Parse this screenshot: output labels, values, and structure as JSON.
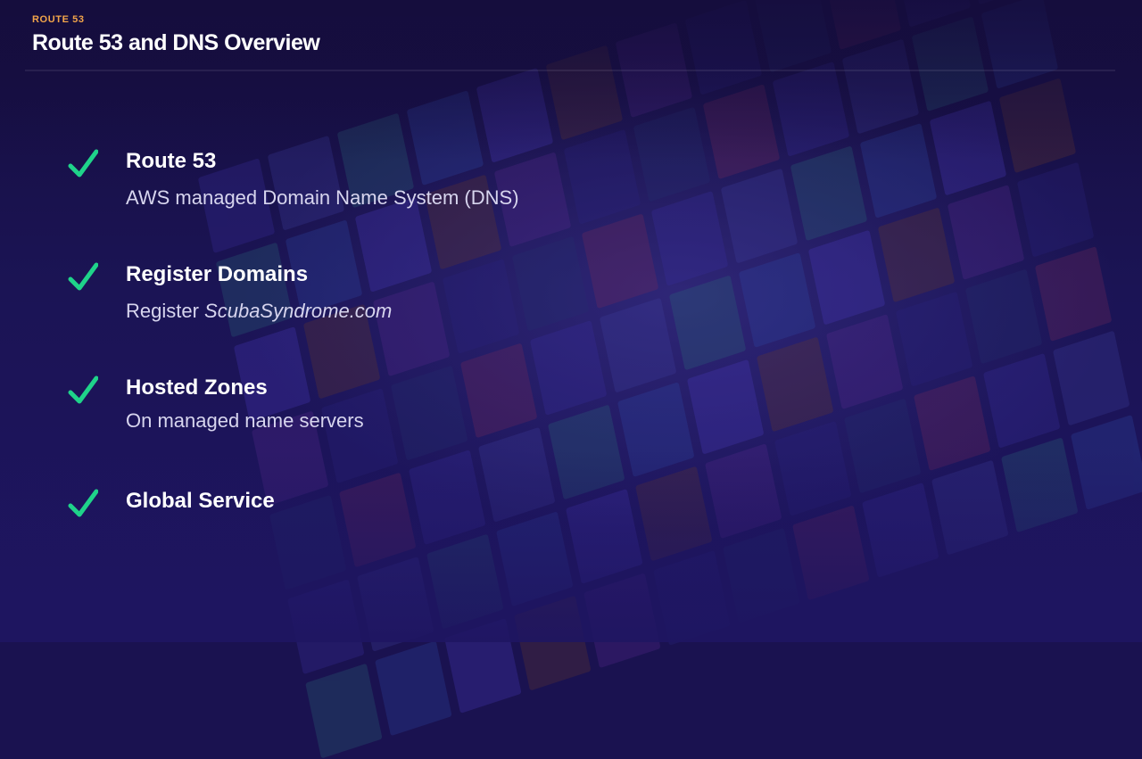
{
  "header": {
    "kicker": "ROUTE 53",
    "title": "Route 53 and DNS Overview"
  },
  "colors": {
    "accent_orange": "#f2a54a",
    "check_green": "#1fd38a",
    "background": "#1a1250"
  },
  "items": [
    {
      "title": "Route 53",
      "desc": "AWS managed Domain Name System (DNS)",
      "icon": "checkmark-icon"
    },
    {
      "title": "Register Domains",
      "desc_prefix": "Register ",
      "desc_emphasis": "ScubaSyndrome.com",
      "icon": "checkmark-icon"
    },
    {
      "title": "Hosted Zones",
      "desc": "On managed name servers",
      "icon": "checkmark-icon"
    },
    {
      "title": "Global Service",
      "icon": "checkmark-icon"
    }
  ]
}
